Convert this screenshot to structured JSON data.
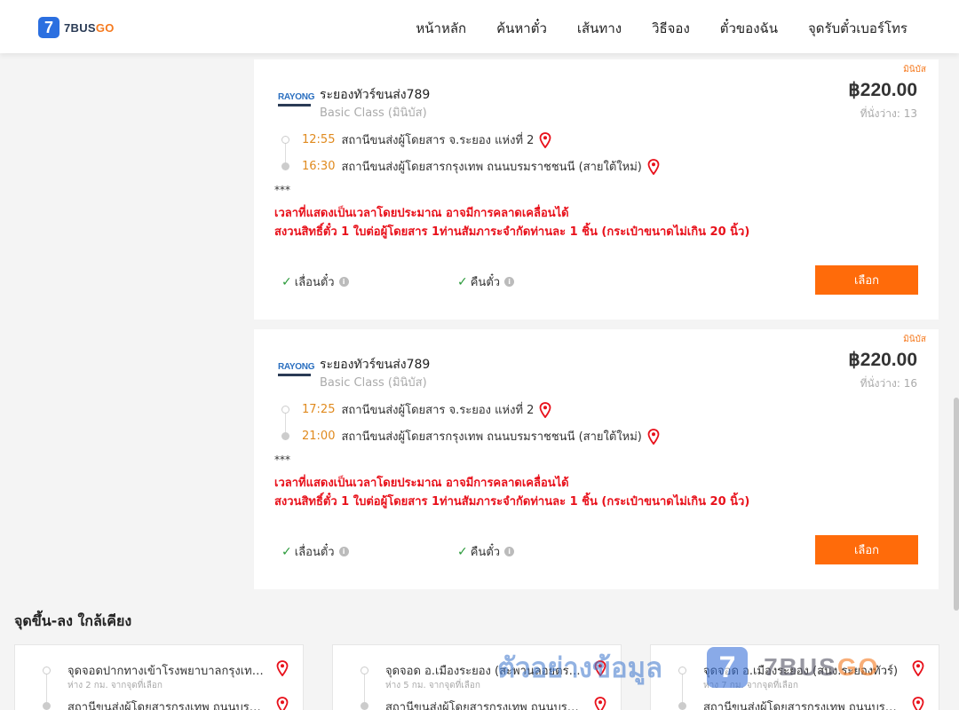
{
  "brand": {
    "badge": "7",
    "name_main": "7BUS",
    "name_accent": "GO"
  },
  "nav": [
    "หน้าหลัก",
    "ค้นหาตั๋ว",
    "เส้นทาง",
    "วิธีจอง",
    "ตั๋วของฉัน",
    "จุดรับตั๋วเบอร์โทร"
  ],
  "trips": [
    {
      "tag": "มินิบัส",
      "operator_logo": "RAYONG",
      "operator": "ระยองทัวร์ขนส่ง789",
      "class": "Basic Class (มินิบัส)",
      "price": "฿220.00",
      "seats": "ที่นั่งว่าง: 13",
      "depart_time": "12:55",
      "depart_station": "สถานีขนส่งผู้โดยสาร จ.ระยอง แห่งที่ 2",
      "arrive_time": "16:30",
      "arrive_station": "สถานีขนส่งผู้โดยสารกรุงเทพ ถนนบรมราชชนนี (สายใต้ใหม่)",
      "stars": "***",
      "warning1": "เวลาที่แสดงเป็นเวลาโดยประมาณ อาจมีการคลาดเคลื่อนได้",
      "warning2": "สงวนสิทธิ์ตั๋ว 1 ใบต่อผู้โดยสาร 1ท่านสัมภาระจำกัดท่านละ 1 ชิ้น (กระเป๋าขนาดไม่เกิน 20 นิ้ว)",
      "feature1": "เลื่อนตั๋ว",
      "feature2": "คืนตั๋ว",
      "button": "เลือก"
    },
    {
      "tag": "มินิบัส",
      "operator_logo": "RAYONG",
      "operator": "ระยองทัวร์ขนส่ง789",
      "class": "Basic Class (มินิบัส)",
      "price": "฿220.00",
      "seats": "ที่นั่งว่าง: 16",
      "depart_time": "17:25",
      "depart_station": "สถานีขนส่งผู้โดยสาร จ.ระยอง แห่งที่ 2",
      "arrive_time": "21:00",
      "arrive_station": "สถานีขนส่งผู้โดยสารกรุงเทพ ถนนบรมราชชนนี (สายใต้ใหม่)",
      "stars": "***",
      "warning1": "เวลาที่แสดงเป็นเวลาโดยประมาณ อาจมีการคลาดเคลื่อนได้",
      "warning2": "สงวนสิทธิ์ตั๋ว 1 ใบต่อผู้โดยสาร 1ท่านสัมภาระจำกัดท่านละ 1 ชิ้น (กระเป๋าขนาดไม่เกิน 20 นิ้ว)",
      "feature1": "เลื่อนตั๋ว",
      "feature2": "คืนตั๋ว",
      "button": "เลือก"
    }
  ],
  "nearby": {
    "title": "จุดขึ้น-ลง ใกล้เคียง",
    "cards": [
      {
        "stop": "จุดจอดปากทางเข้าโรงพยาบาลกรุงเทพระยอง",
        "distance": "ห่าง 2 กม. จากจุดที่เลือก",
        "dest": "สถานีขนส่งผู้โดยสารกรุงเทพ ถนนบรมราชชนนี"
      },
      {
        "stop": "จุดจอด อ.เมืองระยอง (สะพานลอยตรงข้ามตลาด)",
        "distance": "ห่าง 5 กม. จากจุดที่เลือก",
        "dest": "สถานีขนส่งผู้โดยสารกรุงเทพ ถนนบรมราชชนนี"
      },
      {
        "stop": "จุดจอด อ.เมืองระยอง (สนง.ระยองทัวร์)",
        "distance": "ห่าง 7 กม. จากจุดที่เลือก",
        "dest": "สถานีขนส่งผู้โดยสารกรุงเทพ ถนนบรมราชชนนี"
      }
    ]
  },
  "watermark": {
    "text": "ตัวอย่างข้อมูล",
    "badge": "7",
    "brand_main": "7BUS",
    "brand_accent": "GO"
  },
  "colors": {
    "accent": "#ff6b0a",
    "warning": "#e8111b",
    "time": "#e08a1e",
    "brand_blue": "#2b6fe0"
  }
}
